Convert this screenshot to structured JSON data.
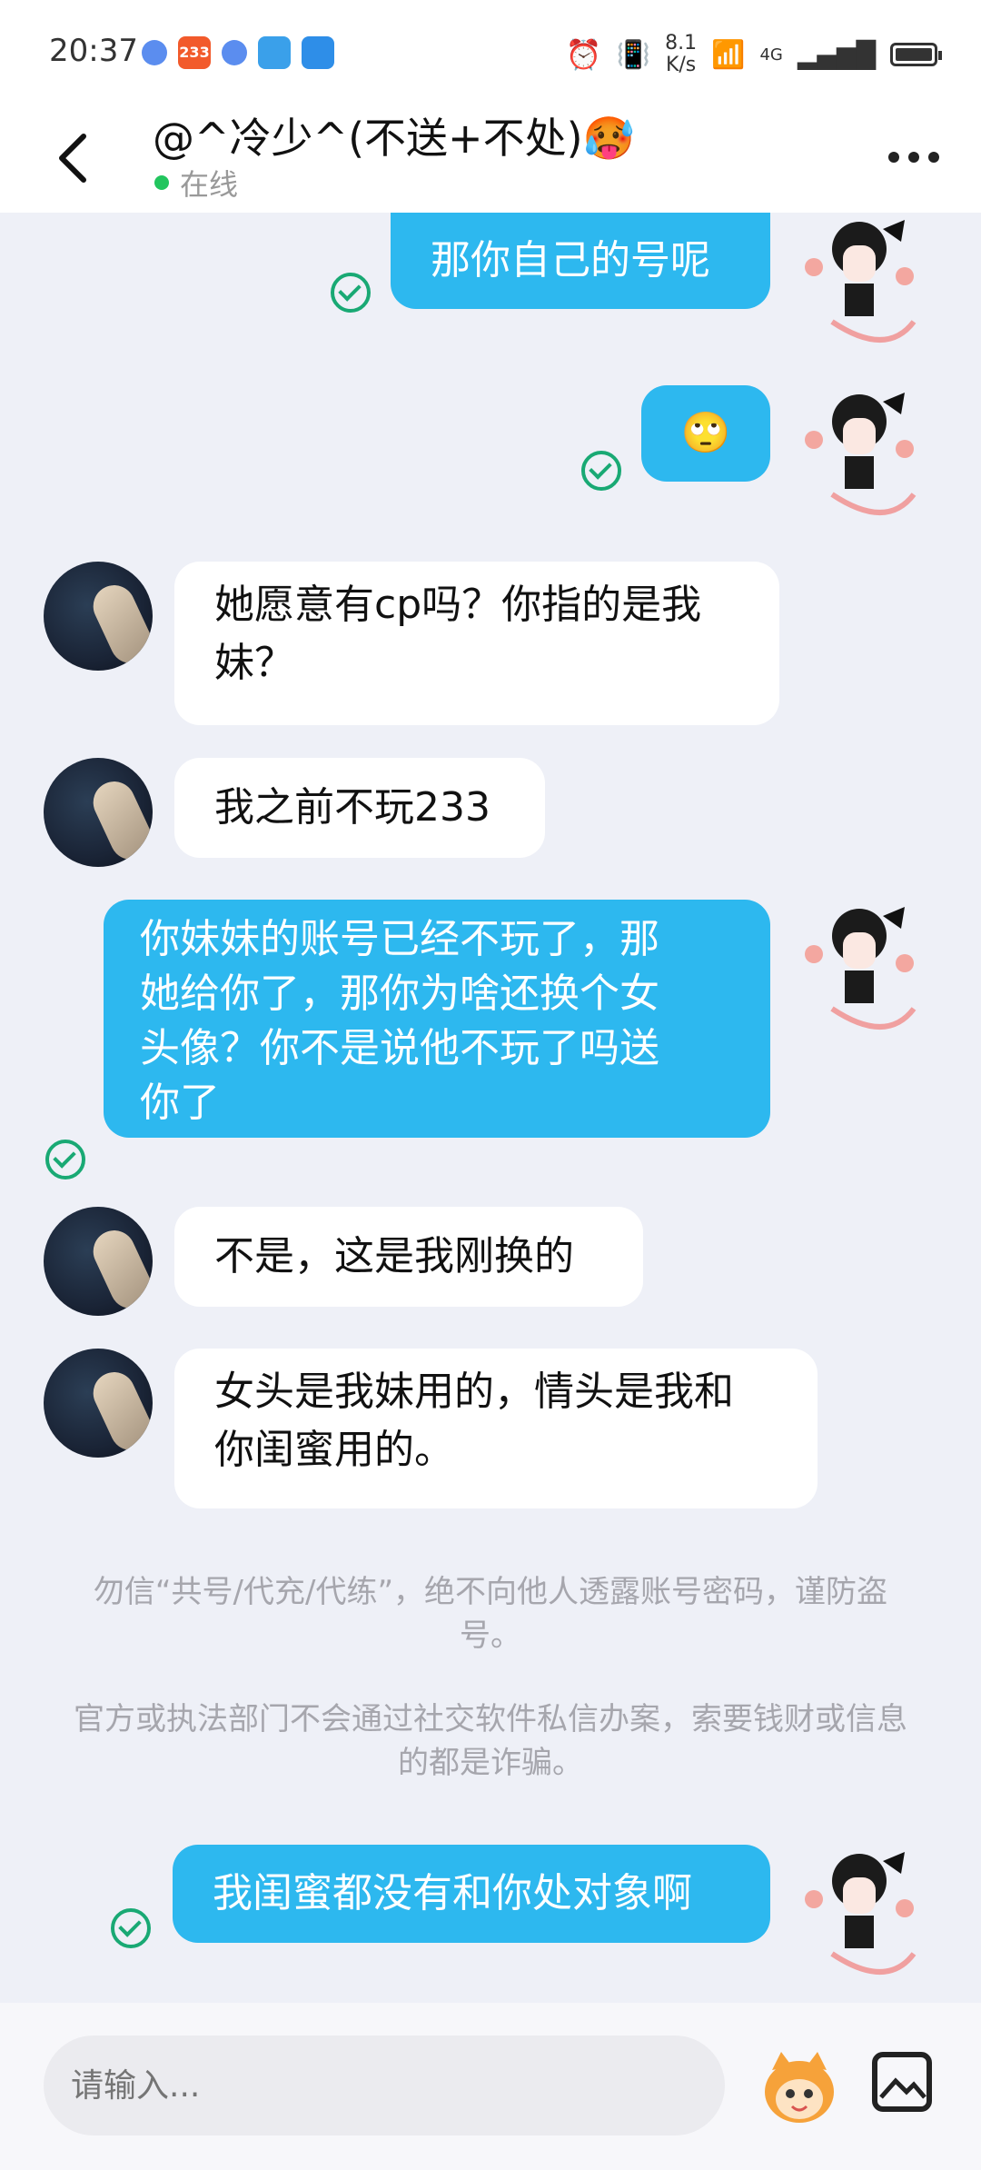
{
  "status": {
    "time": "20:37",
    "net_speed": "8.1\nK/s",
    "network": "4G",
    "app_icon_233": "233"
  },
  "header": {
    "title": "@^冷少^(不送+不处)🥵",
    "status": "在线"
  },
  "messages": [
    {
      "from": "me",
      "text": "那你自己的号呢"
    },
    {
      "from": "me",
      "text": "🙄"
    },
    {
      "from": "other",
      "text": "她愿意有cp吗？你指的是我\n妹？"
    },
    {
      "from": "other",
      "text": "我之前不玩233"
    },
    {
      "from": "me",
      "text": "你妹妹的账号已经不玩了，那\n她给你了，那你为啥还换个女\n头像？你不是说他不玩了吗送\n你了"
    },
    {
      "from": "other",
      "text": "不是，这是我刚换的"
    },
    {
      "from": "other",
      "text": "女头是我妹用的，情头是我和\n你闺蜜用的。"
    },
    {
      "from": "me",
      "text": "我闺蜜都没有和你处对象啊"
    }
  ],
  "notices": [
    "勿信“共号/代充/代练”，绝不向他人透露账号密码，谨防盗号。",
    "官方或执法部门不会通过社交软件私信办案，索要钱财或信息的都是诈骗。"
  ],
  "input": {
    "placeholder": "请输入..."
  },
  "icons": {
    "back": "back-arrow-icon",
    "more": "more-dots-icon",
    "image": "image-icon",
    "mascot": "mascot-icon",
    "read": "check-circle-icon"
  },
  "colors": {
    "sent_bubble": "#2db8ef",
    "received_bubble": "#ffffff",
    "background": "#eef0f7",
    "read_check": "#19a974",
    "online": "#22c55e"
  }
}
